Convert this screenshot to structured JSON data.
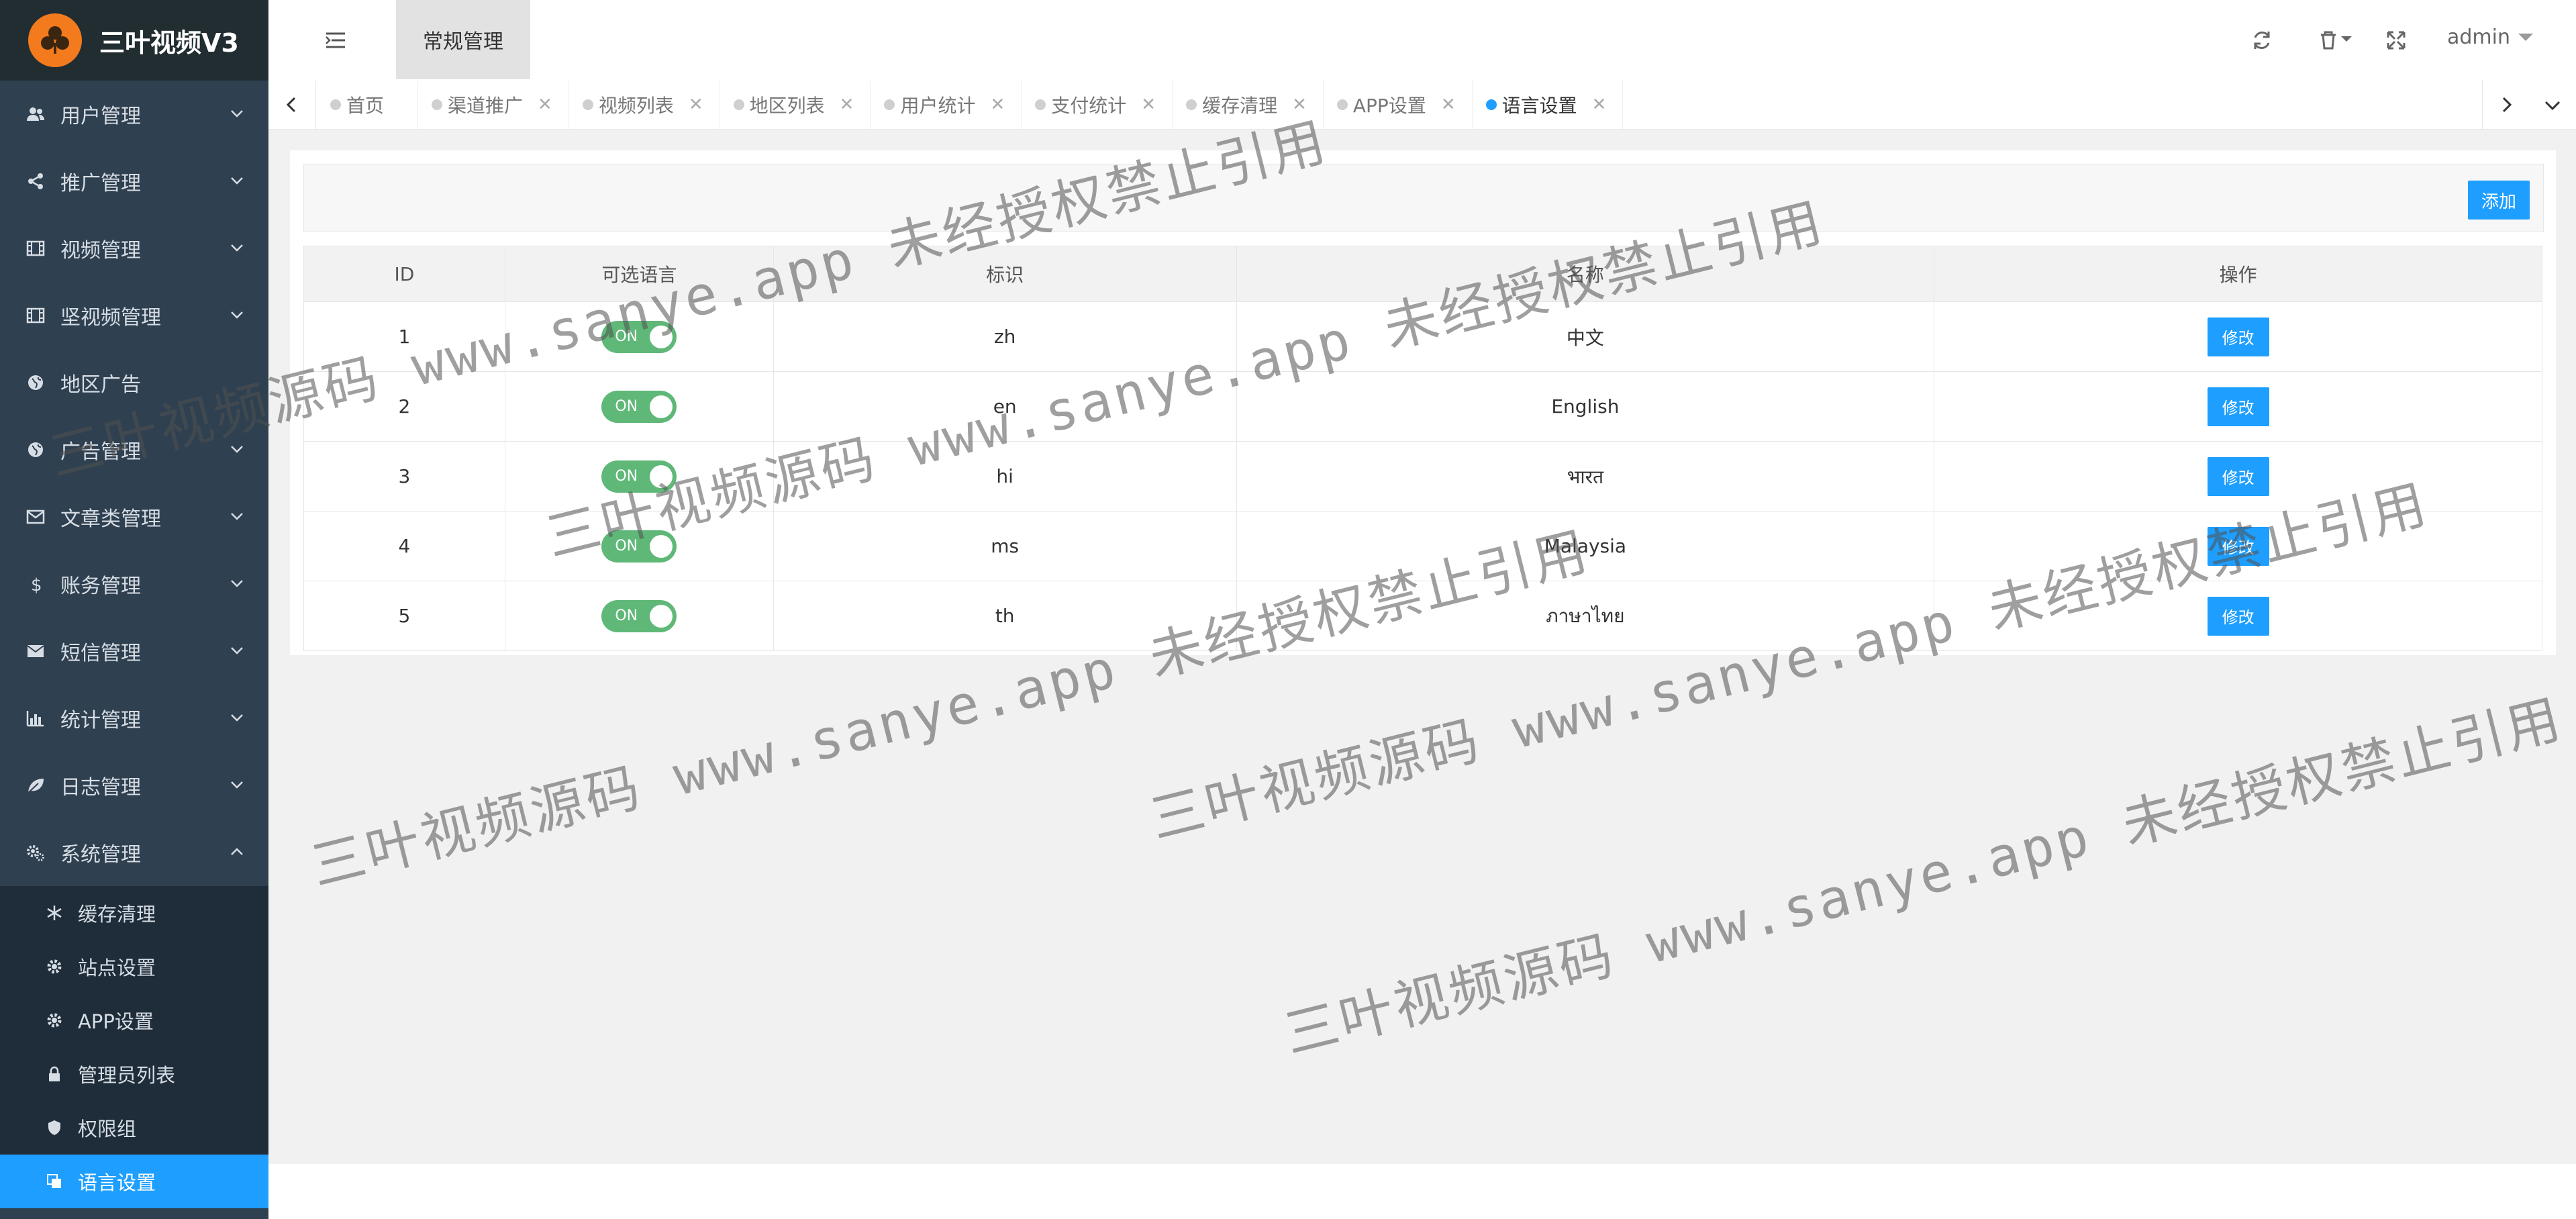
{
  "app": {
    "name": "三叶视频V3"
  },
  "sidebar": {
    "items": [
      {
        "label": "用户管理",
        "icon": "users-icon"
      },
      {
        "label": "推广管理",
        "icon": "share-icon"
      },
      {
        "label": "视频管理",
        "icon": "film-icon"
      },
      {
        "label": "坚视频管理",
        "icon": "film-icon"
      },
      {
        "label": "地区广告",
        "icon": "globe-icon"
      },
      {
        "label": "广告管理",
        "icon": "globe-icon"
      },
      {
        "label": "文章类管理",
        "icon": "envelope-icon"
      },
      {
        "label": "账务管理",
        "icon": "dollar-icon"
      },
      {
        "label": "短信管理",
        "icon": "envelope-filled-icon"
      },
      {
        "label": "统计管理",
        "icon": "bar-chart-icon"
      },
      {
        "label": "日志管理",
        "icon": "leaf-icon"
      },
      {
        "label": "系统管理",
        "icon": "gears-icon"
      }
    ],
    "submenu": [
      {
        "label": "缓存清理",
        "icon": "snowflake-icon"
      },
      {
        "label": "站点设置",
        "icon": "gear-icon"
      },
      {
        "label": "APP设置",
        "icon": "gear-icon"
      },
      {
        "label": "管理员列表",
        "icon": "lock-icon"
      },
      {
        "label": "权限组",
        "icon": "shield-icon"
      },
      {
        "label": "语言设置",
        "icon": "language-icon"
      }
    ]
  },
  "header": {
    "tab": "常规管理",
    "user": "admin"
  },
  "tabs": [
    "首页",
    "渠道推广",
    "视频列表",
    "地区列表",
    "用户统计",
    "支付统计",
    "缓存清理",
    "APP设置",
    "语言设置"
  ],
  "toolbar": {
    "add_label": "添加"
  },
  "table": {
    "headers": [
      "ID",
      "可选语言",
      "标识",
      "名称",
      "操作"
    ],
    "rows": [
      {
        "id": "1",
        "enabled": "ON",
        "code": "zh",
        "name": "中文",
        "action": "修改"
      },
      {
        "id": "2",
        "enabled": "ON",
        "code": "en",
        "name": "English",
        "action": "修改"
      },
      {
        "id": "3",
        "enabled": "ON",
        "code": "hi",
        "name": "भारत",
        "action": "修改"
      },
      {
        "id": "4",
        "enabled": "ON",
        "code": "ms",
        "name": "Malaysia",
        "action": "修改"
      },
      {
        "id": "5",
        "enabled": "ON",
        "code": "th",
        "name": "ภาษาไทย",
        "action": "修改"
      }
    ]
  },
  "watermark": {
    "text": "三叶视频源码 www.sanye.app 未经授权禁止引用"
  },
  "colors": {
    "sidebar": "#2f4050",
    "accent": "#1e9fff",
    "toggle": "#5fb878",
    "logo": "#f37b1d"
  }
}
